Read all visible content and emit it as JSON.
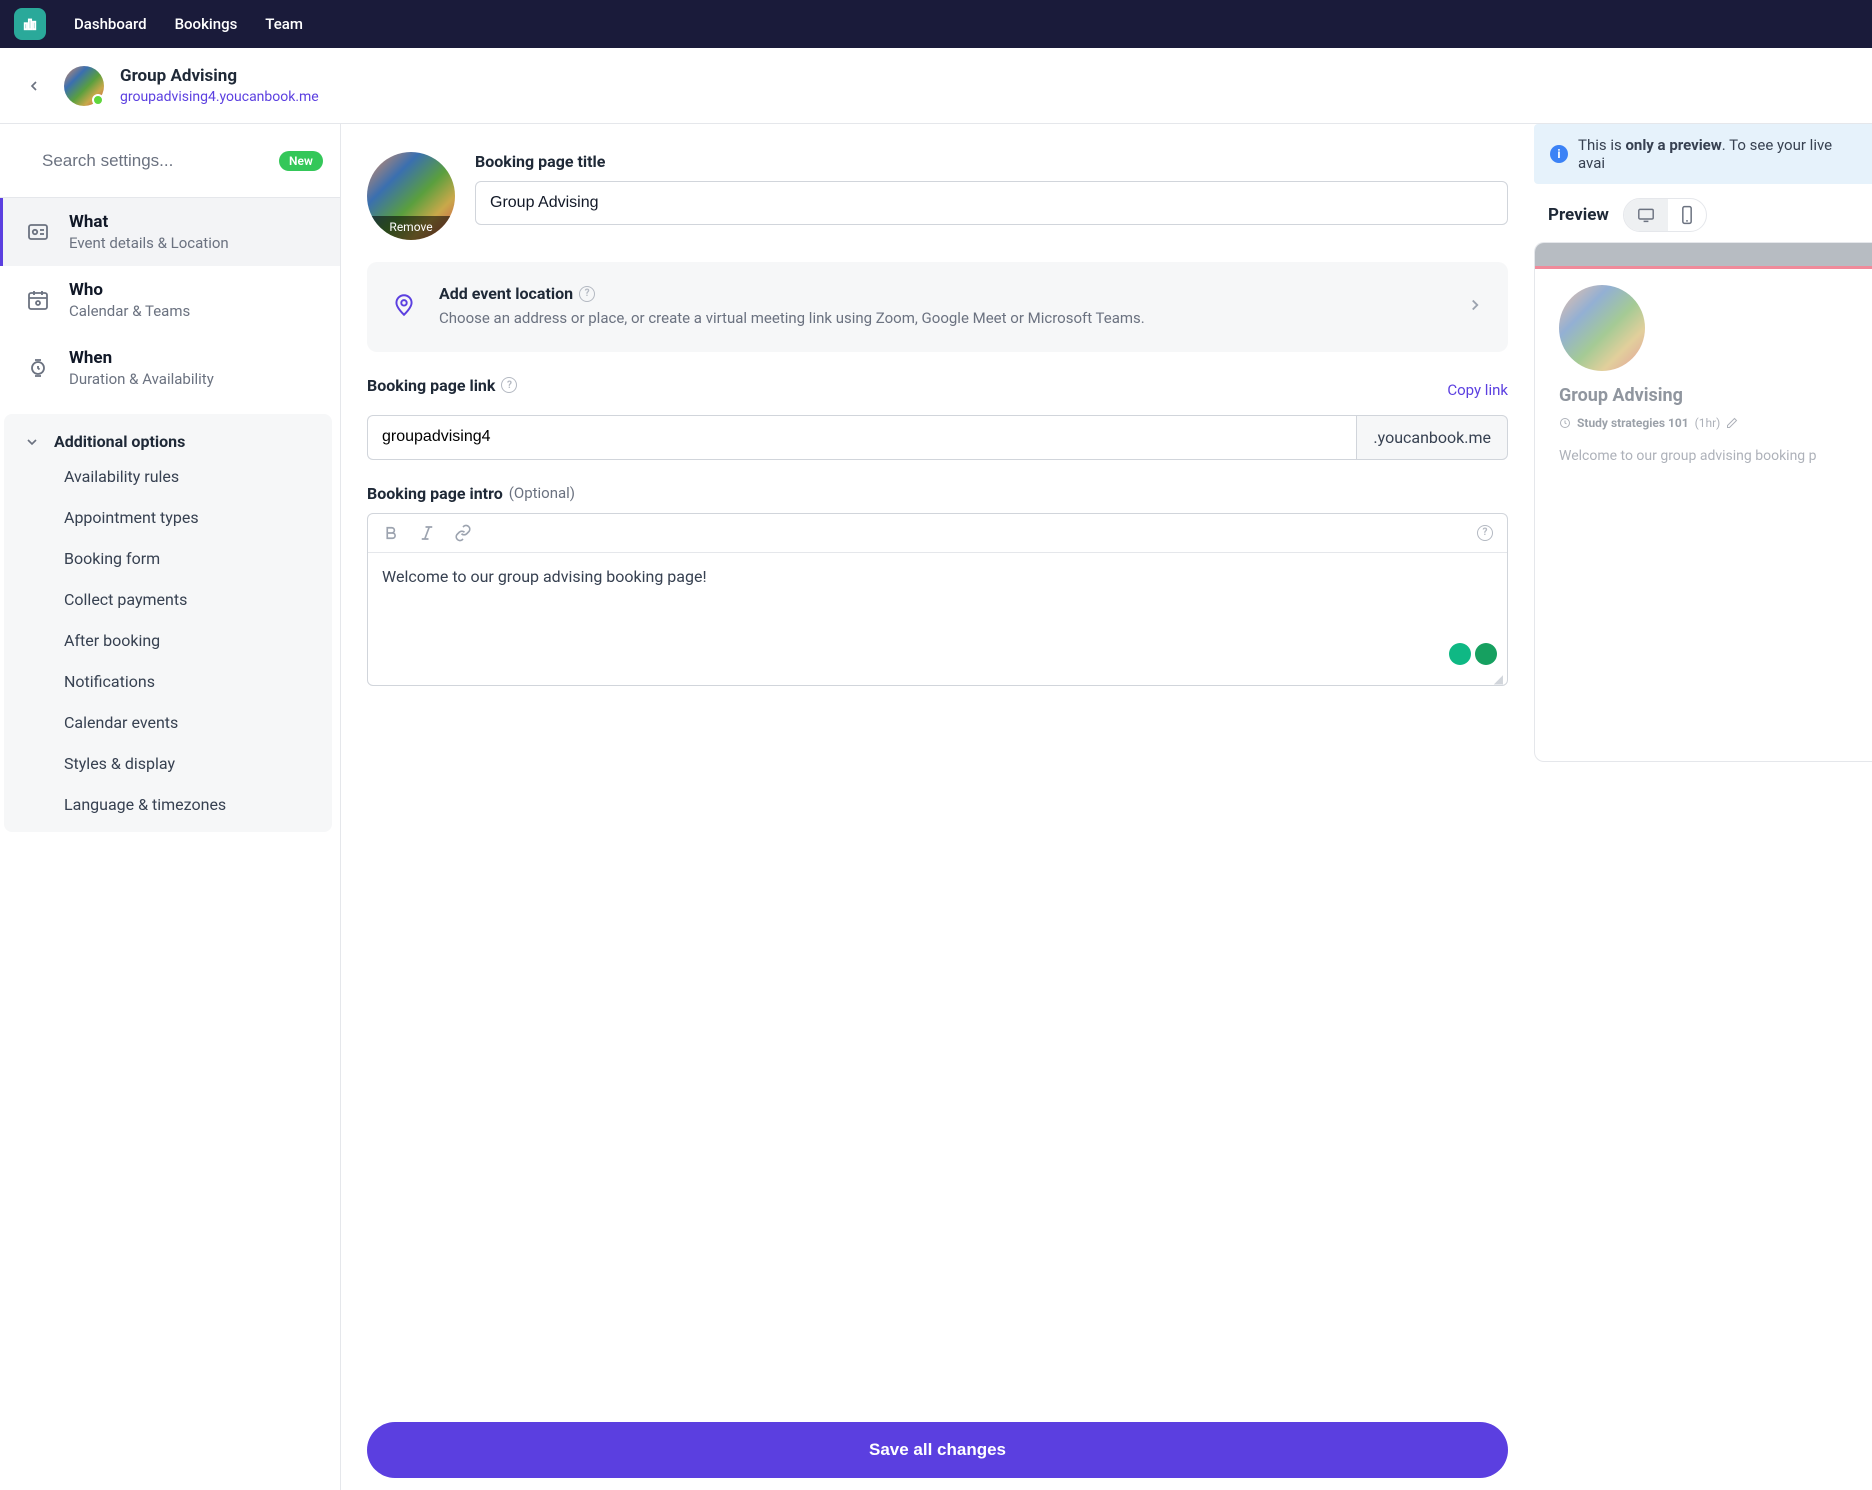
{
  "topnav": {
    "links": [
      "Dashboard",
      "Bookings",
      "Team"
    ]
  },
  "subheader": {
    "page_name": "Group Advising",
    "page_url": "groupadvising4.youcanbook.me"
  },
  "sidebar": {
    "search_placeholder": "Search settings...",
    "new_badge": "New",
    "items": [
      {
        "title": "What",
        "sub": "Event details & Location"
      },
      {
        "title": "Who",
        "sub": "Calendar & Teams"
      },
      {
        "title": "When",
        "sub": "Duration & Availability"
      }
    ],
    "additional_title": "Additional options",
    "additional_items": [
      "Availability rules",
      "Appointment types",
      "Booking form",
      "Collect payments",
      "After booking",
      "Notifications",
      "Calendar events",
      "Styles & display",
      "Language & timezones"
    ]
  },
  "form": {
    "thumb_remove": "Remove",
    "title_label": "Booking page title",
    "title_value": "Group Advising",
    "location_title": "Add event location",
    "location_desc": "Choose an address or place, or create a virtual meeting link using Zoom, Google Meet or Microsoft Teams.",
    "link_label": "Booking page link",
    "copy_link": "Copy link",
    "link_value": "groupadvising4",
    "link_suffix": ".youcanbook.me",
    "intro_label": "Booking page intro",
    "intro_optional": "(Optional)",
    "intro_value": "Welcome to our group advising booking page!",
    "save_label": "Save all changes"
  },
  "preview": {
    "banner_prefix": "This is ",
    "banner_bold": "only a preview",
    "banner_suffix": ". To see your live avai",
    "label": "Preview",
    "title": "Group Advising",
    "study_label": "Study strategies 101",
    "study_dur": "(1hr)",
    "intro": "Welcome to our group advising booking p"
  }
}
